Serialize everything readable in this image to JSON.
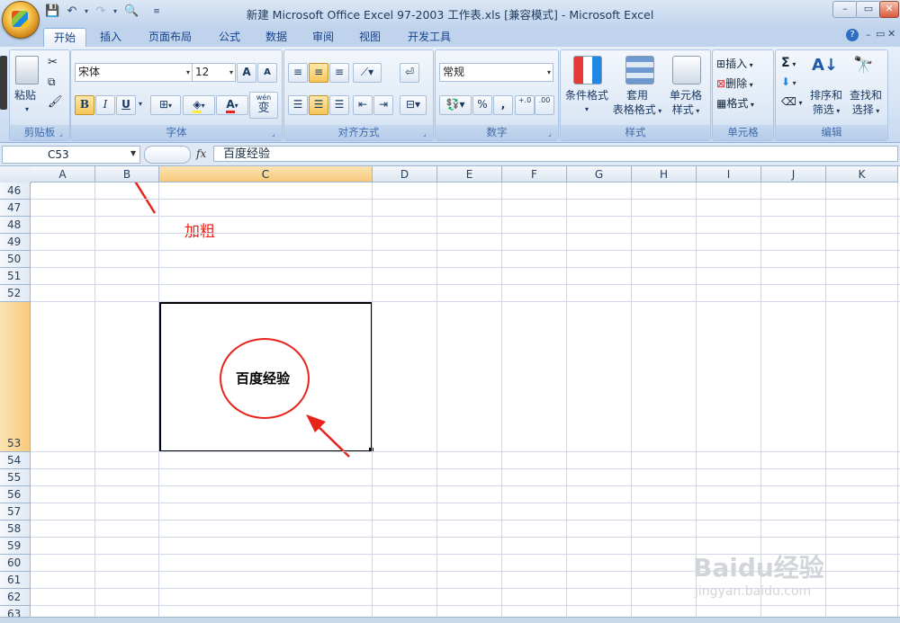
{
  "window": {
    "title": "新建 Microsoft Office Excel 97-2003 工作表.xls  [兼容模式] - Microsoft Excel",
    "controls": {
      "minimize": "–",
      "restore": "▭",
      "close": "✕"
    }
  },
  "tabs": [
    {
      "label": "开始",
      "active": true
    },
    {
      "label": "插入"
    },
    {
      "label": "页面布局"
    },
    {
      "label": "公式"
    },
    {
      "label": "数据"
    },
    {
      "label": "审阅"
    },
    {
      "label": "视图"
    },
    {
      "label": "开发工具"
    }
  ],
  "ribbon": {
    "clipboard": {
      "label": "剪贴板",
      "paste": "粘贴"
    },
    "font": {
      "label": "字体",
      "name": "宋体",
      "size": "12",
      "bold": "B",
      "italic": "I",
      "underline": "U",
      "grow": "A",
      "shrink": "A",
      "fontcolor": "A",
      "phonetic": "wén",
      "phonetic2": "变"
    },
    "alignment": {
      "label": "对齐方式"
    },
    "number": {
      "label": "数字",
      "format": "常规",
      "percent": "%",
      "comma": ",",
      "inc": "+.0",
      "dec": ".00"
    },
    "styles": {
      "label": "样式",
      "cond": "条件格式",
      "table1": "套用",
      "table2": "表格格式",
      "cell1": "单元格",
      "cell2": "样式"
    },
    "cells": {
      "label": "单元格",
      "insert": "插入",
      "delete": "删除",
      "format": "格式"
    },
    "editing": {
      "label": "编辑",
      "sort1": "排序和",
      "sort2": "筛选",
      "find1": "查找和",
      "find2": "选择"
    }
  },
  "formula_bar": {
    "name_box": "C53",
    "fx": "fx",
    "value": "百度经验"
  },
  "grid": {
    "columns": [
      "A",
      "B",
      "C",
      "D",
      "E",
      "F",
      "G",
      "H",
      "I",
      "J",
      "K"
    ],
    "selected_column": "C",
    "rows": [
      "46",
      "47",
      "48",
      "49",
      "50",
      "51",
      "52",
      "53",
      "54",
      "55",
      "56",
      "57",
      "58",
      "59",
      "60",
      "61",
      "62",
      "63"
    ],
    "selected_row": "53",
    "active_cell_text": "百度经验"
  },
  "annotation": {
    "label": "加粗",
    "color": "#e8231b"
  },
  "watermark": {
    "brand": "Baidu经验",
    "url": "jingyan.baidu.com"
  }
}
